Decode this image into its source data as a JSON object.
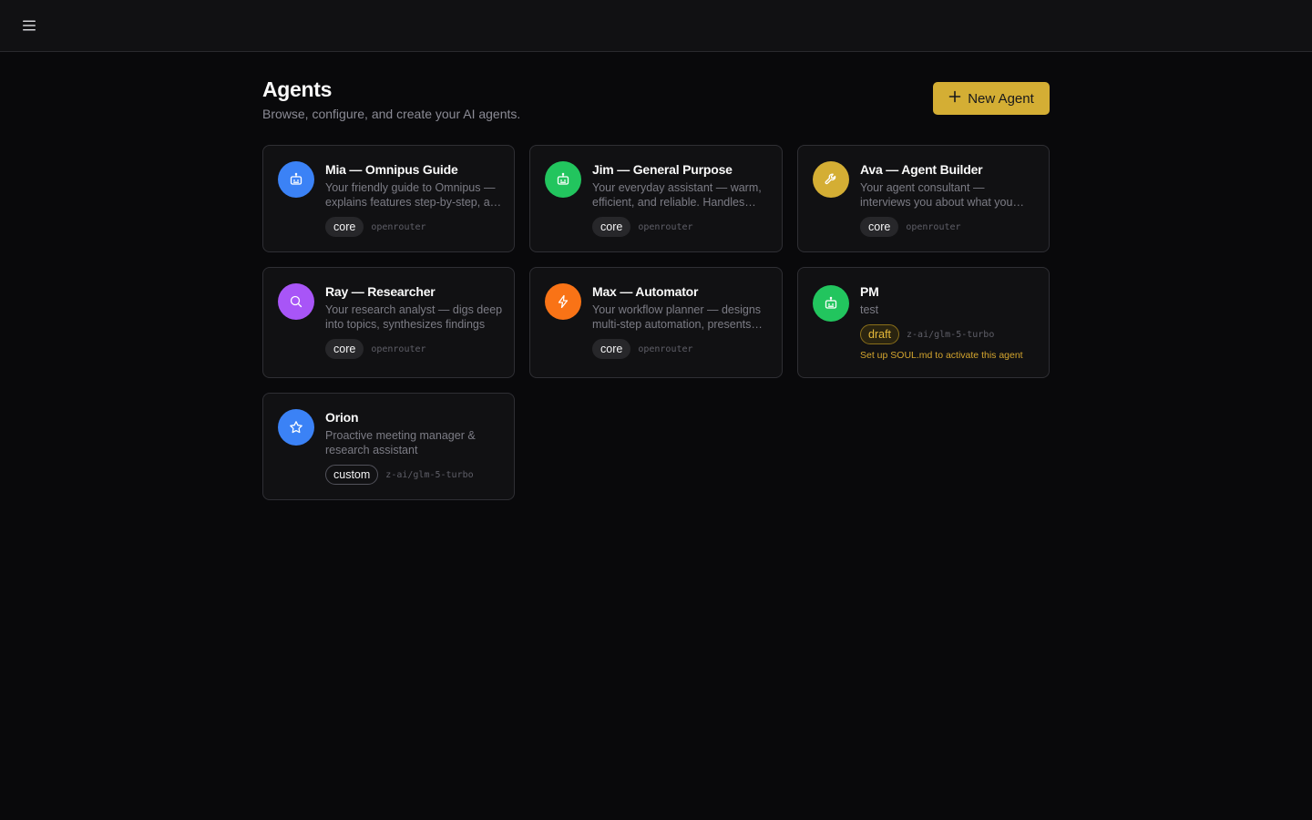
{
  "header": {
    "menu_icon": "hamburger-menu-icon"
  },
  "page": {
    "title": "Agents",
    "subtitle": "Browse, configure, and create your AI agents.",
    "new_agent_label": "New Agent",
    "new_agent_icon": "plus-icon"
  },
  "colors": {
    "accent": "#d4ae34",
    "blue": "#3b82f6",
    "green": "#22c55e",
    "yellow": "#d4ae34",
    "purple": "#a855f7",
    "orange": "#f97316"
  },
  "agents": [
    {
      "name": "Mia — Omnipus Guide",
      "description": "Your friendly guide to Omnipus — explains features step-by-step, and more",
      "badge": "core",
      "model": "openrouter",
      "icon": "robot-icon",
      "color": "#3b82f6"
    },
    {
      "name": "Jim — General Purpose",
      "description": "Your everyday assistant — warm, efficient, and reliable. Handles anything",
      "badge": "core",
      "model": "openrouter",
      "icon": "robot-icon",
      "color": "#22c55e"
    },
    {
      "name": "Ava — Agent Builder",
      "description": "Your agent consultant — interviews you about what you need",
      "badge": "core",
      "model": "openrouter",
      "icon": "wrench-icon",
      "color": "#d4ae34"
    },
    {
      "name": "Ray — Researcher",
      "description": "Your research analyst — digs deep into topics, synthesizes findings",
      "badge": "core",
      "model": "openrouter",
      "icon": "search-icon",
      "color": "#a855f7"
    },
    {
      "name": "Max — Automator",
      "description": "Your workflow planner — designs multi-step automation, presents plans",
      "badge": "core",
      "model": "openrouter",
      "icon": "lightning-icon",
      "color": "#f97316"
    },
    {
      "name": "PM",
      "description": "test",
      "badge": "draft",
      "model": "z-ai/glm-5-turbo",
      "icon": "robot-icon",
      "color": "#22c55e",
      "warning": "Set up SOUL.md to activate this agent"
    },
    {
      "name": "Orion",
      "description": "Proactive meeting manager & research assistant",
      "badge": "custom",
      "model": "z-ai/glm-5-turbo",
      "icon": "star-icon",
      "color": "#3b82f6"
    }
  ]
}
